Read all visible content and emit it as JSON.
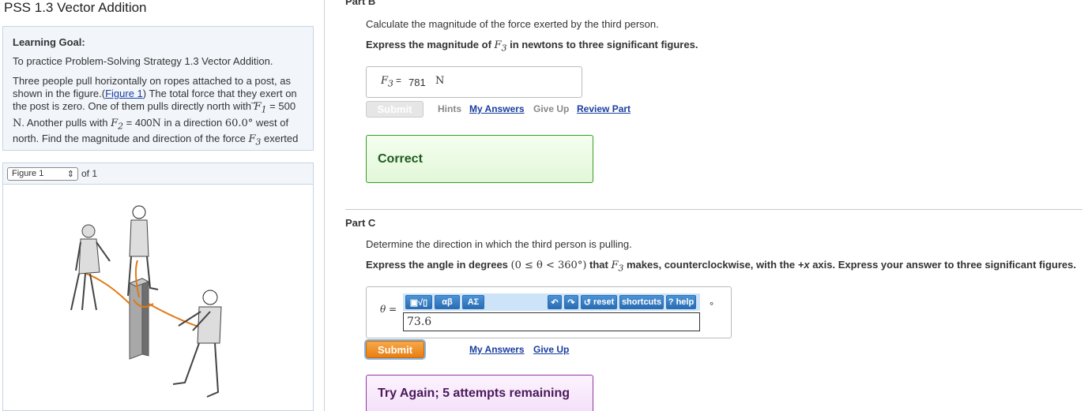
{
  "left": {
    "title": "PSS 1.3 Vector Addition",
    "goal_heading": "Learning Goal:",
    "goal_text": "To practice Problem-Solving Strategy 1.3 Vector Addition.",
    "p1": "Three people pull horizontally on ropes attached to a post, as shown in the figure.(",
    "p1_link": "Figure 1",
    "p1b": ") The total force that they exert on the post is zero. One of them pulls directly north with ",
    "f1_sym": "F",
    "f1_sub": "1",
    "p1c": " = 500",
    "p2a": "N",
    "p2b": ". Another pulls with ",
    "f2_sym": "F",
    "f2_sub": "2",
    "p2c": " = 400",
    "p2d": "N",
    "p2e": " in a direction ",
    "p2f": "60.0°",
    "p2g": " west of",
    "p3": "north. Find the magnitude and direction of the force ",
    "f3_sym": "F",
    "f3_sub": "3",
    "p3b": " exerted",
    "figure_select": "Figure 1",
    "figure_of": "of 1"
  },
  "partB": {
    "heading": "Part B",
    "question": "Calculate the magnitude of the force exerted by the third person.",
    "instr_a": "Express the magnitude of ",
    "instr_sym": "F",
    "instr_sub": "3",
    "instr_b": " in newtons to three significant figures.",
    "ans_sym": "F",
    "ans_sub": "3",
    "ans_eq": "=",
    "ans_value": "781",
    "ans_unit": "N",
    "submit": "Submit",
    "hints": "Hints",
    "my_answers": "My Answers",
    "give_up": "Give Up",
    "review": "Review Part",
    "feedback": "Correct"
  },
  "partC": {
    "heading": "Part C",
    "question": "Determine the direction in which the third person is pulling.",
    "instr_a": "Express the angle in degrees ",
    "instr_range": "(0 ≤ θ < 360°)",
    "instr_b": " that ",
    "instr_sym": "F",
    "instr_sub": "3",
    "instr_c": " makes, counterclockwise, with the ",
    "instr_axis": "+x",
    "instr_d": " axis. Express your answer to three significant figures.",
    "theta_label": "θ =",
    "toolbar": {
      "templates": "▣√▯",
      "greek": "αβ",
      "symbols": "ΑΣ",
      "reset": "reset",
      "shortcuts": "shortcuts",
      "help": "help"
    },
    "input_value": "73.6",
    "unit": "°",
    "submit": "Submit",
    "my_answers": "My Answers",
    "give_up": "Give Up",
    "feedback": "Try Again; 5 attempts remaining"
  }
}
